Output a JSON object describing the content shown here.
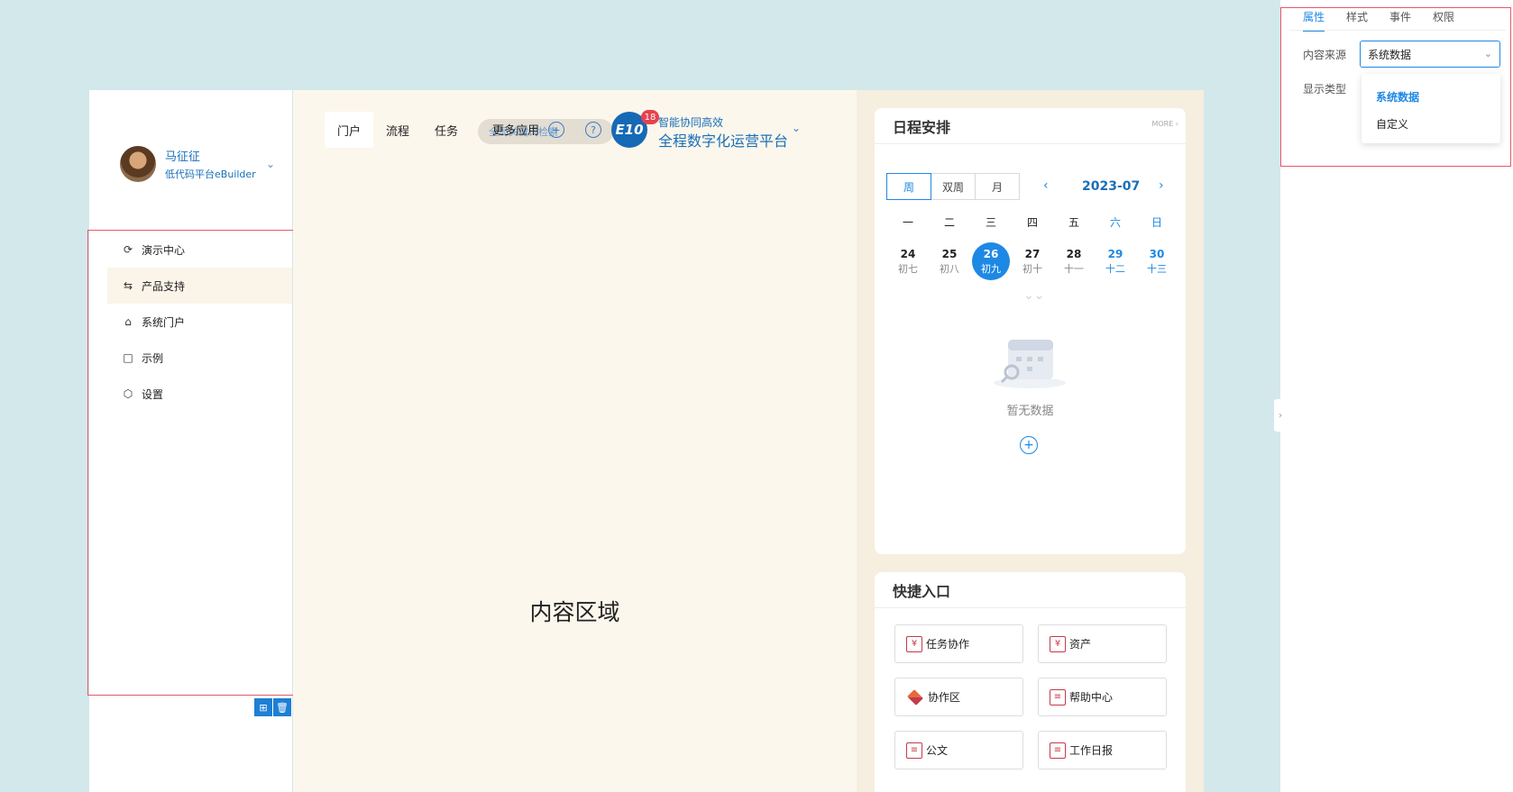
{
  "user": {
    "name": "马征征",
    "org": "低代码平台eBuilder"
  },
  "sidebar": {
    "items": [
      {
        "label": "演示中心",
        "icon": "rocket-icon"
      },
      {
        "label": "产品支持",
        "icon": "swap-icon",
        "active": true
      },
      {
        "label": "系统门户",
        "icon": "home-icon"
      },
      {
        "label": "示例",
        "icon": "monitor-icon"
      },
      {
        "label": "设置",
        "icon": "gear-icon"
      }
    ]
  },
  "main": {
    "tabs": [
      {
        "label": "门户",
        "active": true
      },
      {
        "label": "流程"
      },
      {
        "label": "任务"
      }
    ],
    "more_apps": "更多应用",
    "search_placeholder": "全局关键词检索",
    "brand_logo": "E10",
    "badge_count": "18",
    "brand_tag": "智能协同高效",
    "brand_title": "全程数字化运营平台",
    "content_label": "内容区域"
  },
  "schedule": {
    "title": "日程安排",
    "more": "MORE",
    "view_tabs": [
      "周",
      "双周",
      "月"
    ],
    "active_view": "周",
    "month": "2023-07",
    "weekdays": [
      "一",
      "二",
      "三",
      "四",
      "五",
      "六",
      "日"
    ],
    "days": [
      {
        "day": "24",
        "lunar": "初七"
      },
      {
        "day": "25",
        "lunar": "初八"
      },
      {
        "day": "26",
        "lunar": "初九",
        "today": true
      },
      {
        "day": "27",
        "lunar": "初十"
      },
      {
        "day": "28",
        "lunar": "十一"
      },
      {
        "day": "29",
        "lunar": "十二",
        "weekend": true
      },
      {
        "day": "30",
        "lunar": "十三",
        "weekend": true
      }
    ],
    "empty_text": "暂无数据"
  },
  "quick": {
    "title": "快捷入口",
    "items": [
      {
        "label": "任务协作",
        "icon": "yuan-icon"
      },
      {
        "label": "资产",
        "icon": "yuan-icon"
      },
      {
        "label": "协作区",
        "icon": "stack-icon"
      },
      {
        "label": "帮助中心",
        "icon": "doc-icon"
      },
      {
        "label": "公文",
        "icon": "doc-icon"
      },
      {
        "label": "工作日报",
        "icon": "doc-icon"
      }
    ]
  },
  "panel": {
    "tabs": [
      "属性",
      "样式",
      "事件",
      "权限"
    ],
    "active_tab": "属性",
    "content_source_label": "内容来源",
    "content_source_value": "系统数据",
    "display_type_label": "显示类型",
    "options": [
      "系统数据",
      "自定义"
    ],
    "selected_option": "系统数据"
  },
  "colors": {
    "accent": "#1e88e5",
    "sidebar_active": "#fbf4e9",
    "main_bg": "#fcf7ec",
    "canvas_bg": "#d3e8ea"
  }
}
